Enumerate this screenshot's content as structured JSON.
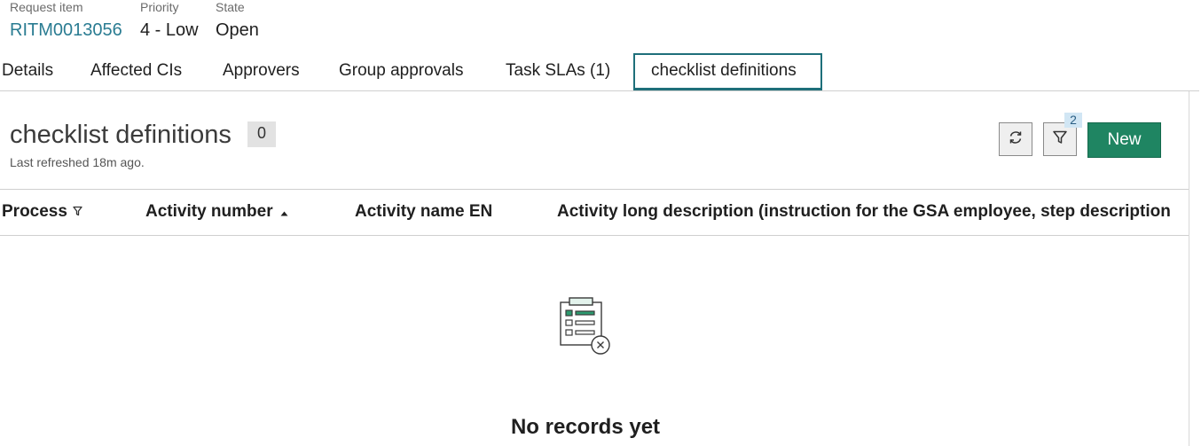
{
  "record": {
    "request_item_label": "Request item",
    "request_item_value": "RITM0013056",
    "priority_label": "Priority",
    "priority_value": "4 - Low",
    "state_label": "State",
    "state_value": "Open"
  },
  "tabs": [
    {
      "label": "Details"
    },
    {
      "label": "Affected CIs"
    },
    {
      "label": "Approvers"
    },
    {
      "label": "Group approvals"
    },
    {
      "label": "Task SLAs (1)"
    },
    {
      "label": "checklist definitions",
      "active": true
    }
  ],
  "list": {
    "title": "checklist definitions",
    "count": "0",
    "last_refreshed": "Last refreshed 18m ago.",
    "filter_count": "2",
    "new_label": "New",
    "columns": [
      {
        "label": "Process",
        "icon": "filter-icon"
      },
      {
        "label": "Activity number",
        "icon": "sort-ascending-icon"
      },
      {
        "label": "Activity name EN"
      },
      {
        "label": "Activity long description (instruction for the GSA employee, step description"
      }
    ],
    "empty_text": "No records yet"
  },
  "colors": {
    "accent": "#1e6f7a",
    "link": "#2a7c92",
    "primary_button": "#1f8562"
  }
}
